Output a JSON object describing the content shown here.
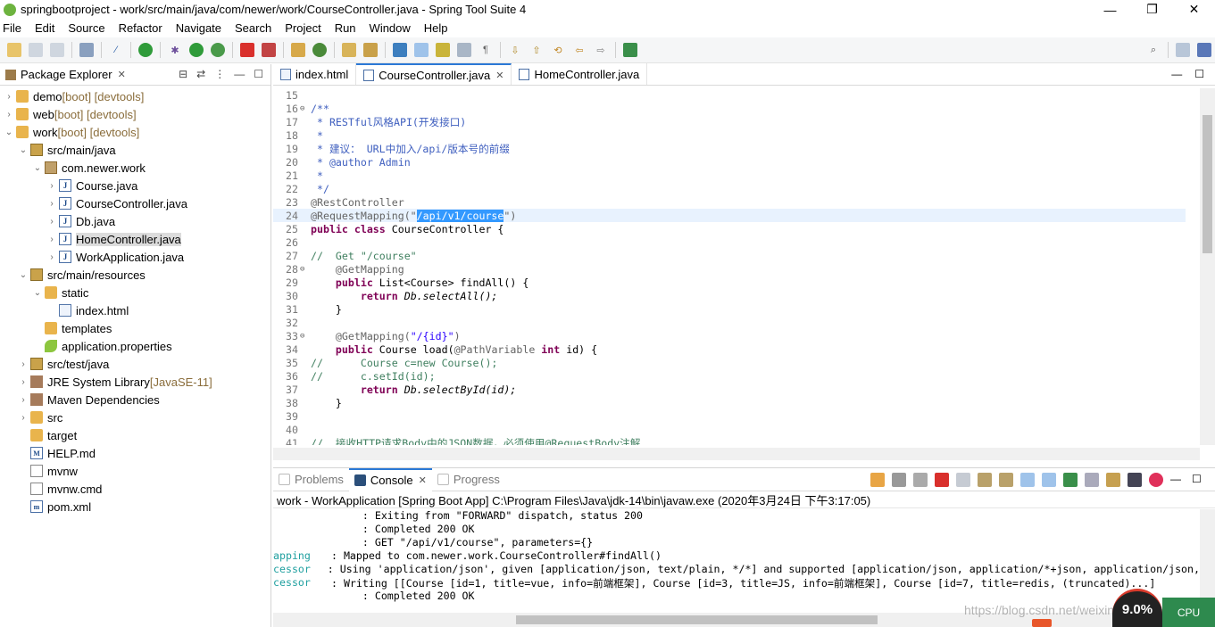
{
  "window": {
    "title": "springbootproject - work/src/main/java/com/newer/work/CourseController.java - Spring Tool Suite 4",
    "minimize": "—",
    "maximize": "❐",
    "close": "✕"
  },
  "menu": [
    "File",
    "Edit",
    "Source",
    "Refactor",
    "Navigate",
    "Search",
    "Project",
    "Run",
    "Window",
    "Help"
  ],
  "package_explorer": {
    "tab_label": "Package Explorer",
    "items": [
      {
        "name": "demo",
        "suffix": " [boot] [devtools]"
      },
      {
        "name": "web",
        "suffix": " [boot] [devtools]"
      },
      {
        "name": "work",
        "suffix": " [boot] [devtools]"
      },
      {
        "name": "src/main/java",
        "suffix": ""
      },
      {
        "name": "com.newer.work",
        "suffix": ""
      },
      {
        "name": "Course.java",
        "suffix": ""
      },
      {
        "name": "CourseController.java",
        "suffix": ""
      },
      {
        "name": "Db.java",
        "suffix": ""
      },
      {
        "name": "HomeController.java",
        "suffix": ""
      },
      {
        "name": "WorkApplication.java",
        "suffix": ""
      },
      {
        "name": "src/main/resources",
        "suffix": ""
      },
      {
        "name": "static",
        "suffix": ""
      },
      {
        "name": "index.html",
        "suffix": ""
      },
      {
        "name": "templates",
        "suffix": ""
      },
      {
        "name": "application.properties",
        "suffix": ""
      },
      {
        "name": "src/test/java",
        "suffix": ""
      },
      {
        "name": "JRE System Library",
        "suffix": " [JavaSE-11]"
      },
      {
        "name": "Maven Dependencies",
        "suffix": ""
      },
      {
        "name": "src",
        "suffix": ""
      },
      {
        "name": "target",
        "suffix": ""
      },
      {
        "name": "HELP.md",
        "suffix": ""
      },
      {
        "name": "mvnw",
        "suffix": ""
      },
      {
        "name": "mvnw.cmd",
        "suffix": ""
      },
      {
        "name": "pom.xml",
        "suffix": ""
      }
    ]
  },
  "editor": {
    "tabs": [
      "index.html",
      "CourseController.java",
      "HomeController.java"
    ],
    "lines": {
      "l15": "15",
      "l16": "16",
      "l17": "17",
      "l18": "18",
      "l19": "19",
      "l20": "20",
      "l21": "21",
      "l22": "22",
      "l23": "23",
      "l24": "24",
      "l25": "25",
      "l26": "26",
      "l27": "27",
      "l28": "28",
      "l29": "29",
      "l30": "30",
      "l31": "31",
      "l32": "32",
      "l33": "33",
      "l34": "34",
      "l35": "35",
      "l36": "36",
      "l37": "37",
      "l38": "38",
      "l39": "39",
      "l40": "40",
      "l41": "41"
    },
    "code": {
      "c16": "/**",
      "c17": " * RESTful风格API(开发接口)",
      "c18": " *",
      "c19": " * 建议： URL中加入/api/版本号的前缀",
      "c20": " * @author Admin",
      "c21": " *",
      "c22": " */",
      "c23": "@RestController",
      "c24a": "@RequestMapping(\"",
      "c24sel": "/api/v1/course",
      "c24b": "\")",
      "c25kw": "public class",
      "c25": " CourseController {",
      "c27": "//  Get \"/course\"",
      "c28": "    @GetMapping",
      "c29kw": "    public",
      "c29": " List<Course> findAll() {",
      "c30kw": "        return",
      "c30": " Db.selectAll();",
      "c31": "    }",
      "c33a": "    @GetMapping(",
      "c33s": "\"/{id}\"",
      "c33b": ")",
      "c34kw": "    public",
      "c34a": " Course load(",
      "c34an": "@PathVariable",
      "c34kw2": " int",
      "c34b": " id) {",
      "c35": "//      Course c=new Course();",
      "c36": "//      c.setId(id);",
      "c37kw": "        return",
      "c37": " Db.selectById(id);",
      "c38": "    }",
      "c41": "//  接收HTTP请求Body中的JSON数据，必须使用@RequestBody注解"
    }
  },
  "console": {
    "tabs": [
      "Problems",
      "Console",
      "Progress"
    ],
    "process": "work - WorkApplication [Spring Boot App] C:\\Program Files\\Java\\jdk-14\\bin\\javaw.exe (2020年3月24日 下午3:17:05)",
    "lines": [
      {
        "pfx": "",
        "text": "      : Exiting from \"FORWARD\" dispatch, status 200"
      },
      {
        "pfx": "",
        "text": "      : Completed 200 OK"
      },
      {
        "pfx": "",
        "text": "      : GET \"/api/v1/course\", parameters={}"
      },
      {
        "pfx": "apping",
        "text": " : Mapped to com.newer.work.CourseController#findAll()"
      },
      {
        "pfx": "cessor",
        "text": " : Using 'application/json', given [application/json, text/plain, */*] and supported [application/json, application/*+json, application/json,"
      },
      {
        "pfx": "cessor",
        "text": " : Writing [[Course [id=1, title=vue, info=前端框架], Course [id=3, title=JS, info=前端框架], Course [id=7, title=redis, (truncated)...]"
      },
      {
        "pfx": "",
        "text": "      : Completed 200 OK"
      }
    ]
  },
  "overlay": {
    "meter": "9.0%",
    "panel": "CPU",
    "watermark": "https://blog.csdn.net/weixin_43366414"
  }
}
